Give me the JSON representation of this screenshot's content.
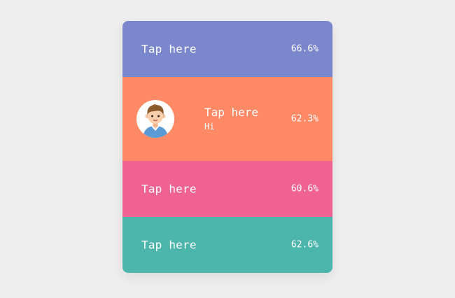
{
  "rows": [
    {
      "label": "Tap here",
      "percent": "66.6%",
      "color": "#7b87cc"
    },
    {
      "label": "Tap here",
      "subtitle": "Hi",
      "percent": "62.3%",
      "color": "#ff8a65",
      "avatar": "boy-avatar-icon"
    },
    {
      "label": "Tap here",
      "percent": "60.6%",
      "color": "#f06292"
    },
    {
      "label": "Tap here",
      "percent": "62.6%",
      "color": "#4db6ac"
    }
  ]
}
